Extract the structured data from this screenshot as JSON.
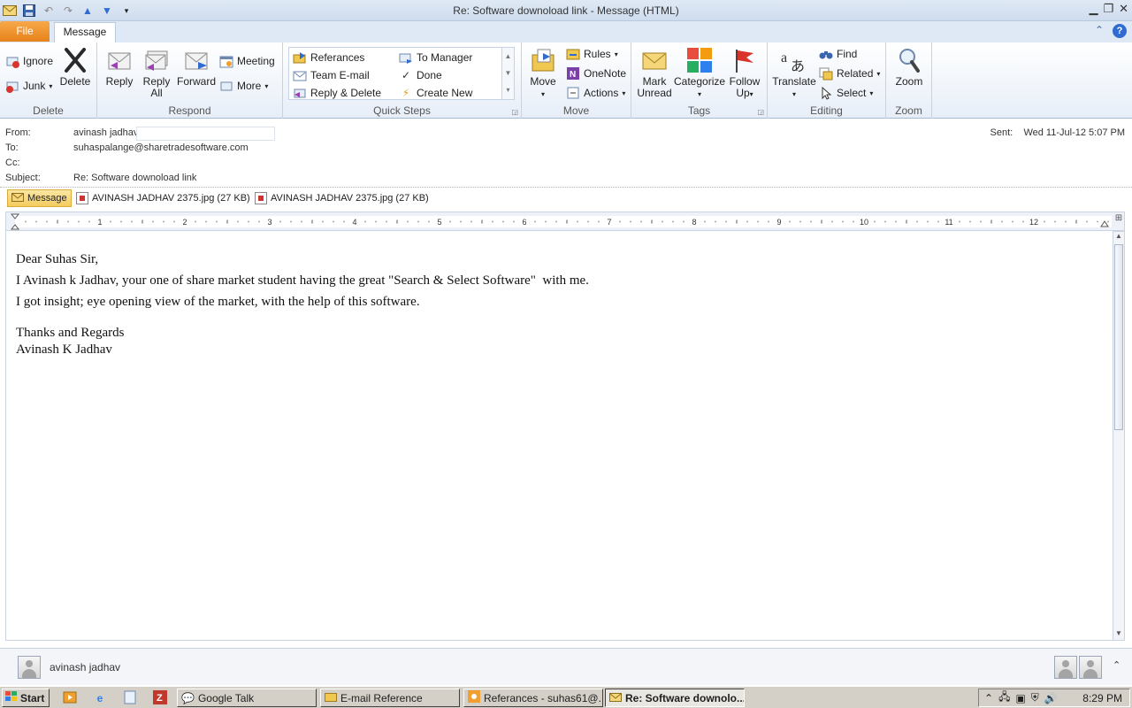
{
  "window": {
    "title": "Re: Software downoload link  - Message (HTML)"
  },
  "tabs": {
    "file": "File",
    "message": "Message"
  },
  "ribbon": {
    "delete": {
      "ignore": "Ignore",
      "delete": "Delete",
      "junk": "Junk",
      "group": "Delete"
    },
    "respond": {
      "reply": "Reply",
      "reply_all_1": "Reply",
      "reply_all_2": "All",
      "forward": "Forward",
      "meeting": "Meeting",
      "more": "More",
      "group": "Respond"
    },
    "quick_steps": {
      "items": [
        "Referances",
        "To Manager",
        "Team E-mail",
        "Done",
        "Reply & Delete",
        "Create New"
      ],
      "group": "Quick Steps"
    },
    "move": {
      "move": "Move",
      "rules": "Rules",
      "onenote": "OneNote",
      "actions": "Actions",
      "group": "Move"
    },
    "tags": {
      "mark_unread_1": "Mark",
      "mark_unread_2": "Unread",
      "categorize": "Categorize",
      "follow_up_1": "Follow",
      "follow_up_2": "Up",
      "group": "Tags"
    },
    "editing": {
      "translate": "Translate",
      "find": "Find",
      "related": "Related",
      "select": "Select",
      "group": "Editing"
    },
    "zoom": {
      "zoom": "Zoom",
      "group": "Zoom"
    }
  },
  "header": {
    "from_label": "From:",
    "from": "avinash jadhav",
    "to_label": "To:",
    "to": "suhaspalange@sharetradesoftware.com",
    "cc_label": "Cc:",
    "subject_label": "Subject:",
    "subject": "Re: Software downoload link",
    "sent_label": "Sent:",
    "sent": "Wed 11-Jul-12 5:07 PM"
  },
  "attachments": {
    "message_tab": "Message",
    "files": [
      "AVINASH JADHAV 2375.jpg (27 KB)",
      "AVINASH JADHAV 2375.jpg (27 KB)"
    ]
  },
  "ruler": {
    "numbers": [
      "1",
      "2",
      "3",
      "4",
      "5",
      "6",
      "7",
      "8",
      "9",
      "10",
      "11",
      "12"
    ]
  },
  "body": {
    "greeting": "Dear Suhas Sir,",
    "line1": "I Avinash k Jadhav, your one of share market student having the great \"Search & Select Software\"  with me.",
    "line2": "I got insight; eye opening view of the market, with the help of this software.",
    "closing": "Thanks and Regards",
    "signature": "Avinash K Jadhav"
  },
  "people_pane": {
    "name": "avinash jadhav"
  },
  "taskbar": {
    "start": "Start",
    "items": [
      "Google Talk",
      "E-mail Reference",
      "Referances - suhas61@...",
      "Re: Software downolo..."
    ],
    "clock": "8:29 PM"
  }
}
